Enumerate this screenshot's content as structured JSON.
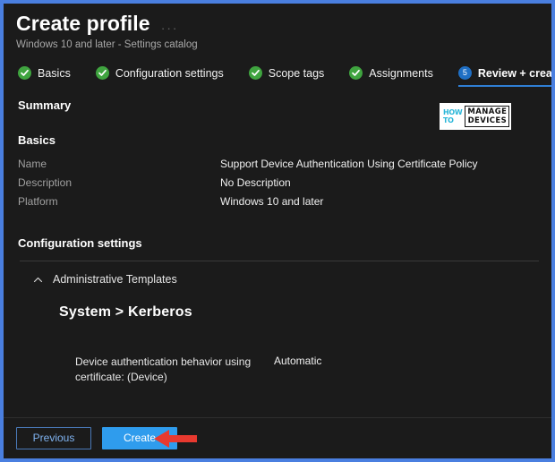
{
  "header": {
    "title": "Create profile",
    "more_options": "···",
    "subtitle": "Windows 10 and later - Settings catalog"
  },
  "steps": [
    {
      "label": "Basics",
      "state": "done",
      "badge": "check"
    },
    {
      "label": "Configuration settings",
      "state": "done",
      "badge": "check"
    },
    {
      "label": "Scope tags",
      "state": "done",
      "badge": "check"
    },
    {
      "label": "Assignments",
      "state": "done",
      "badge": "check"
    },
    {
      "label": "Review + create",
      "state": "active",
      "badge": "5"
    }
  ],
  "content": {
    "summary_heading": "Summary",
    "basics_heading": "Basics",
    "basics_rows": [
      {
        "key": "Name",
        "value": "Support Device Authentication Using Certificate Policy"
      },
      {
        "key": "Description",
        "value": "No Description"
      },
      {
        "key": "Platform",
        "value": "Windows 10 and later"
      }
    ],
    "config_heading": "Configuration settings",
    "group": {
      "label": "Administrative Templates",
      "expanded": true,
      "heading": "System > Kerberos",
      "settings": [
        {
          "name": "Device authentication behavior using certificate: (Device)",
          "value": "Automatic"
        }
      ]
    }
  },
  "watermark": {
    "line1": "HOW",
    "line2": "TO",
    "line3": "MANAGE",
    "line4": "DEVICES"
  },
  "footer": {
    "previous_label": "Previous",
    "create_label": "Create"
  },
  "colors": {
    "frame_border": "#4a7fe0",
    "page_background": "#1b1b1b",
    "step_done": "#3fa43f",
    "step_active": "#1f6fc4",
    "active_underline": "#2f7fd4",
    "primary_button": "#2f9ced",
    "secondary_button_border": "#4a79b8",
    "annotation_arrow": "#e8392f",
    "watermark_accent": "#29b6d8"
  }
}
